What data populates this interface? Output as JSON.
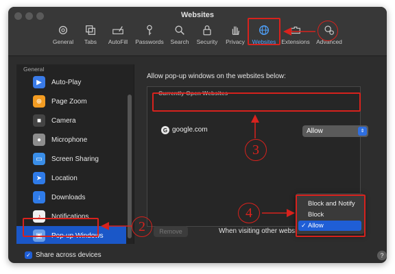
{
  "window": {
    "title": "Websites"
  },
  "toolbar": {
    "items": [
      {
        "label": "General",
        "icon": "gear-icon"
      },
      {
        "label": "Tabs",
        "icon": "tabs-icon"
      },
      {
        "label": "AutoFill",
        "icon": "autofill-icon"
      },
      {
        "label": "Passwords",
        "icon": "key-icon"
      },
      {
        "label": "Search",
        "icon": "search-icon"
      },
      {
        "label": "Security",
        "icon": "lock-icon"
      },
      {
        "label": "Privacy",
        "icon": "hand-icon"
      },
      {
        "label": "Websites",
        "icon": "globe-icon",
        "active": true
      },
      {
        "label": "Extensions",
        "icon": "puzzle-icon"
      },
      {
        "label": "Advanced",
        "icon": "advanced-gears-icon"
      }
    ]
  },
  "sidebar": {
    "header": "General",
    "items": [
      {
        "label": "Auto-Play",
        "icon": "play-icon",
        "color": "#3a7be8"
      },
      {
        "label": "Page Zoom",
        "icon": "zoom-icon",
        "color": "#f39c22"
      },
      {
        "label": "Camera",
        "icon": "camera-icon",
        "color": "#444444"
      },
      {
        "label": "Microphone",
        "icon": "microphone-icon",
        "color": "#8d8d8d"
      },
      {
        "label": "Screen Sharing",
        "icon": "screen-icon",
        "color": "#3a8ee8"
      },
      {
        "label": "Location",
        "icon": "location-icon",
        "color": "#2f7be8"
      },
      {
        "label": "Downloads",
        "icon": "download-icon",
        "color": "#2f7be8"
      },
      {
        "label": "Notifications",
        "icon": "bell-icon",
        "color": "#f0f0f0"
      },
      {
        "label": "Pop-up Windows",
        "icon": "popup-icon",
        "color": "#6b9fe8",
        "selected": true
      }
    ]
  },
  "content": {
    "heading": "Allow pop-up windows on the websites below:",
    "list_header": "Currently Open Websites",
    "site": {
      "favicon": "G",
      "name": "google.com",
      "setting": "Allow"
    },
    "remove_label": "Remove",
    "visiting_label": "When visiting other websites"
  },
  "menu": {
    "options": [
      "Block and Notify",
      "Block",
      "Allow"
    ],
    "selected": "Allow",
    "check": "✓"
  },
  "footer": {
    "share_label": "Share across devices",
    "help": "?"
  },
  "annotations": {
    "callouts": [
      "2",
      "3",
      "4"
    ],
    "color": "#d8221d"
  }
}
